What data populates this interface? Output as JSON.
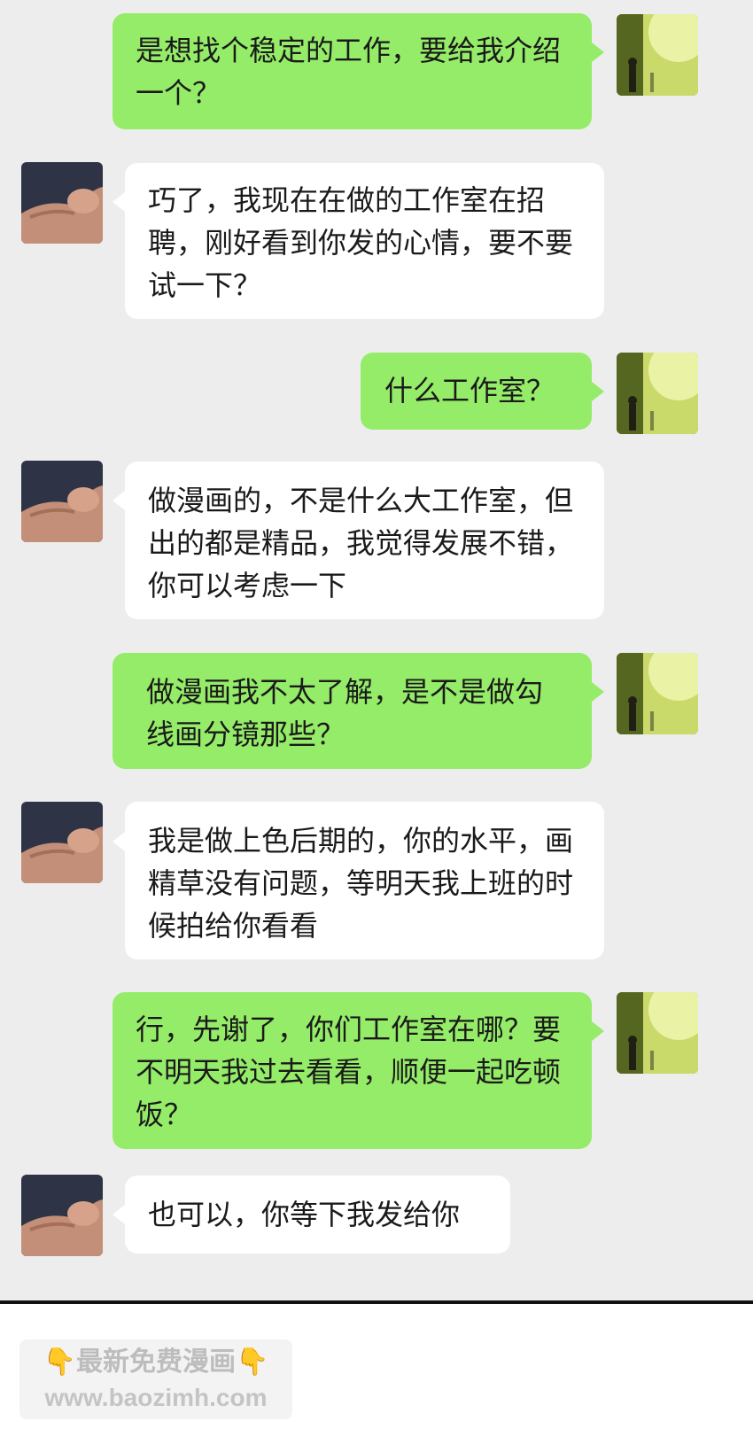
{
  "messages": [
    {
      "side": "right",
      "text": "是想找个稳定的工作，要给我介绍一个？"
    },
    {
      "side": "left",
      "text": "巧了，我现在在做的工作室在招聘，刚好看到你发的心情，要不要试一下？"
    },
    {
      "side": "right",
      "text": "什么工作室？"
    },
    {
      "side": "left",
      "text": "做漫画的，不是什么大工作室，但出的都是精品，我觉得发展不错，你可以考虑一下"
    },
    {
      "side": "right",
      "text": "做漫画我不太了解，是不是做勾线画分镜那些？"
    },
    {
      "side": "left",
      "text": "我是做上色后期的，你的水平，画精草没有问题，等明天我上班的时候拍给你看看"
    },
    {
      "side": "right",
      "text": "行，先谢了，你们工作室在哪？要不明天我过去看看，顺便一起吃顿饭？"
    },
    {
      "side": "left",
      "text": "也可以，你等下我发给你"
    }
  ],
  "watermark": {
    "emoji": "👇",
    "title": "最新免费漫画",
    "url": "www.baozimh.com"
  },
  "colors": {
    "background": "#ededed",
    "bubble_self": "#95ec69",
    "bubble_other": "#ffffff"
  },
  "icons": {
    "self_avatar": "sunlit-forest-avatar-icon",
    "other_avatar": "muscular-arm-avatar-icon"
  }
}
